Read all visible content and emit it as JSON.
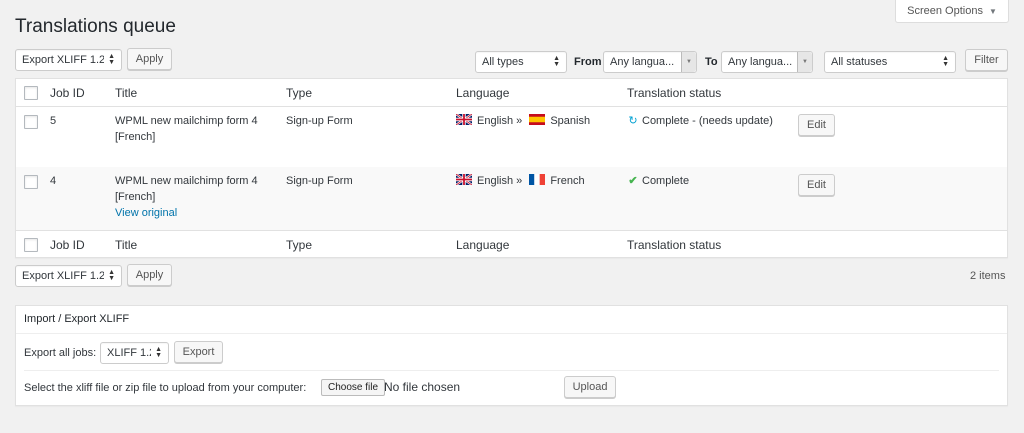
{
  "header": {
    "title": "Translations queue",
    "screen_options": "Screen Options"
  },
  "bulk_top": {
    "selected": "Export XLIFF 1.2",
    "apply": "Apply"
  },
  "filters": {
    "type": "All types",
    "from_label": "From",
    "from_value": "Any langua...",
    "to_label": "To",
    "to_value": "Any langua...",
    "status": "All statuses",
    "filter_button": "Filter"
  },
  "table": {
    "columns": [
      "Job ID",
      "Title",
      "Type",
      "Language",
      "Translation status"
    ],
    "rows": [
      {
        "job_id": "5",
        "title_line1": "WPML new mailchimp form 4",
        "title_line2": "[French]",
        "type": "Sign-up Form",
        "source_lang": "English »",
        "target_lang": "Spanish",
        "status": "Complete - (needs update)",
        "status_icon": "refresh-icon",
        "edit": "Edit"
      },
      {
        "job_id": "4",
        "title_line1": "WPML new mailchimp form 4",
        "title_line2": "[French]",
        "view_original": "View original",
        "type": "Sign-up Form",
        "source_lang": "English »",
        "target_lang": "French",
        "status": "Complete",
        "status_icon": "checkmark-icon",
        "edit": "Edit"
      }
    ]
  },
  "bulk_bottom": {
    "selected": "Export XLIFF 1.2",
    "apply": "Apply",
    "count": "2 items"
  },
  "xliff_panel": {
    "title": "Import / Export XLIFF",
    "export_label": "Export all jobs:",
    "format": "XLIFF 1.2",
    "export_button": "Export",
    "upload_label": "Select the xliff file or zip file to upload from your computer:",
    "choose_file": "Choose file",
    "no_file": "No file chosen",
    "upload_button": "Upload"
  },
  "colors": {
    "link": "#0073aa",
    "check": "#46b450",
    "refresh": "#00a0d2"
  }
}
